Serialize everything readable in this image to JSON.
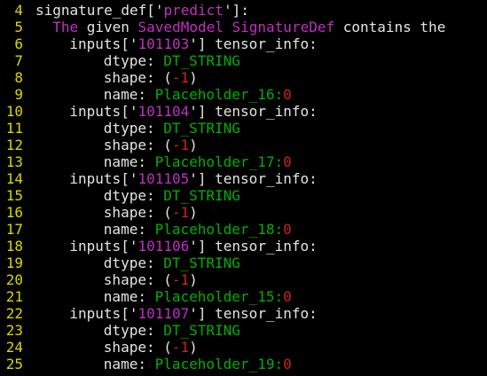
{
  "editor": {
    "colors": {
      "background": "#000000",
      "line_number": "#d7d700",
      "text": "#e4e4e4",
      "string": "#c030c0",
      "constant": "#00b000",
      "number": "#d02020"
    },
    "lines": [
      {
        "num": "4",
        "indent": 0,
        "tokens": [
          {
            "t": "signature_def['",
            "s": "plain"
          },
          {
            "t": "predict",
            "s": "str"
          },
          {
            "t": "']:",
            "s": "plain"
          }
        ]
      },
      {
        "num": "5",
        "indent": 2,
        "tokens": [
          {
            "t": "The",
            "s": "str"
          },
          {
            "t": " given ",
            "s": "plain"
          },
          {
            "t": "SavedModel",
            "s": "str"
          },
          {
            "t": " ",
            "s": "plain"
          },
          {
            "t": "SignatureDef",
            "s": "str"
          },
          {
            "t": " contains the",
            "s": "plain"
          }
        ]
      },
      {
        "num": "6",
        "indent": 4,
        "tokens": [
          {
            "t": "inputs['",
            "s": "plain"
          },
          {
            "t": "101103",
            "s": "str"
          },
          {
            "t": "'] tensor_info:",
            "s": "plain"
          }
        ]
      },
      {
        "num": "7",
        "indent": 8,
        "tokens": [
          {
            "t": "dtype: ",
            "s": "plain"
          },
          {
            "t": "DT_STRING",
            "s": "const"
          }
        ]
      },
      {
        "num": "8",
        "indent": 8,
        "tokens": [
          {
            "t": "shape: (",
            "s": "plain"
          },
          {
            "t": "-1",
            "s": "num"
          },
          {
            "t": ")",
            "s": "plain"
          }
        ]
      },
      {
        "num": "9",
        "indent": 8,
        "tokens": [
          {
            "t": "name: ",
            "s": "plain"
          },
          {
            "t": "Placeholder_16:",
            "s": "const"
          },
          {
            "t": "0",
            "s": "num"
          }
        ]
      },
      {
        "num": "10",
        "indent": 4,
        "tokens": [
          {
            "t": "inputs['",
            "s": "plain"
          },
          {
            "t": "101104",
            "s": "str"
          },
          {
            "t": "'] tensor_info:",
            "s": "plain"
          }
        ]
      },
      {
        "num": "11",
        "indent": 8,
        "tokens": [
          {
            "t": "dtype: ",
            "s": "plain"
          },
          {
            "t": "DT_STRING",
            "s": "const"
          }
        ]
      },
      {
        "num": "12",
        "indent": 8,
        "tokens": [
          {
            "t": "shape: (",
            "s": "plain"
          },
          {
            "t": "-1",
            "s": "num"
          },
          {
            "t": ")",
            "s": "plain"
          }
        ]
      },
      {
        "num": "13",
        "indent": 8,
        "tokens": [
          {
            "t": "name: ",
            "s": "plain"
          },
          {
            "t": "Placeholder_17:",
            "s": "const"
          },
          {
            "t": "0",
            "s": "num"
          }
        ]
      },
      {
        "num": "14",
        "indent": 4,
        "tokens": [
          {
            "t": "inputs['",
            "s": "plain"
          },
          {
            "t": "101105",
            "s": "str"
          },
          {
            "t": "'] tensor_info:",
            "s": "plain"
          }
        ]
      },
      {
        "num": "15",
        "indent": 8,
        "tokens": [
          {
            "t": "dtype: ",
            "s": "plain"
          },
          {
            "t": "DT_STRING",
            "s": "const"
          }
        ]
      },
      {
        "num": "16",
        "indent": 8,
        "tokens": [
          {
            "t": "shape: (",
            "s": "plain"
          },
          {
            "t": "-1",
            "s": "num"
          },
          {
            "t": ")",
            "s": "plain"
          }
        ]
      },
      {
        "num": "17",
        "indent": 8,
        "tokens": [
          {
            "t": "name: ",
            "s": "plain"
          },
          {
            "t": "Placeholder_18:",
            "s": "const"
          },
          {
            "t": "0",
            "s": "num"
          }
        ]
      },
      {
        "num": "18",
        "indent": 4,
        "tokens": [
          {
            "t": "inputs['",
            "s": "plain"
          },
          {
            "t": "101106",
            "s": "str"
          },
          {
            "t": "'] tensor_info:",
            "s": "plain"
          }
        ]
      },
      {
        "num": "19",
        "indent": 8,
        "tokens": [
          {
            "t": "dtype: ",
            "s": "plain"
          },
          {
            "t": "DT_STRING",
            "s": "const"
          }
        ]
      },
      {
        "num": "20",
        "indent": 8,
        "tokens": [
          {
            "t": "shape: (",
            "s": "plain"
          },
          {
            "t": "-1",
            "s": "num"
          },
          {
            "t": ")",
            "s": "plain"
          }
        ]
      },
      {
        "num": "21",
        "indent": 8,
        "tokens": [
          {
            "t": "name: ",
            "s": "plain"
          },
          {
            "t": "Placeholder_15:",
            "s": "const"
          },
          {
            "t": "0",
            "s": "num"
          }
        ]
      },
      {
        "num": "22",
        "indent": 4,
        "tokens": [
          {
            "t": "inputs['",
            "s": "plain"
          },
          {
            "t": "101107",
            "s": "str"
          },
          {
            "t": "'] tensor_info:",
            "s": "plain"
          }
        ]
      },
      {
        "num": "23",
        "indent": 8,
        "tokens": [
          {
            "t": "dtype: ",
            "s": "plain"
          },
          {
            "t": "DT_STRING",
            "s": "const"
          }
        ]
      },
      {
        "num": "24",
        "indent": 8,
        "tokens": [
          {
            "t": "shape: (",
            "s": "plain"
          },
          {
            "t": "-1",
            "s": "num"
          },
          {
            "t": ")",
            "s": "plain"
          }
        ]
      },
      {
        "num": "25",
        "indent": 8,
        "tokens": [
          {
            "t": "name: ",
            "s": "plain"
          },
          {
            "t": "Placeholder_19:",
            "s": "const"
          },
          {
            "t": "0",
            "s": "num"
          }
        ]
      }
    ]
  }
}
